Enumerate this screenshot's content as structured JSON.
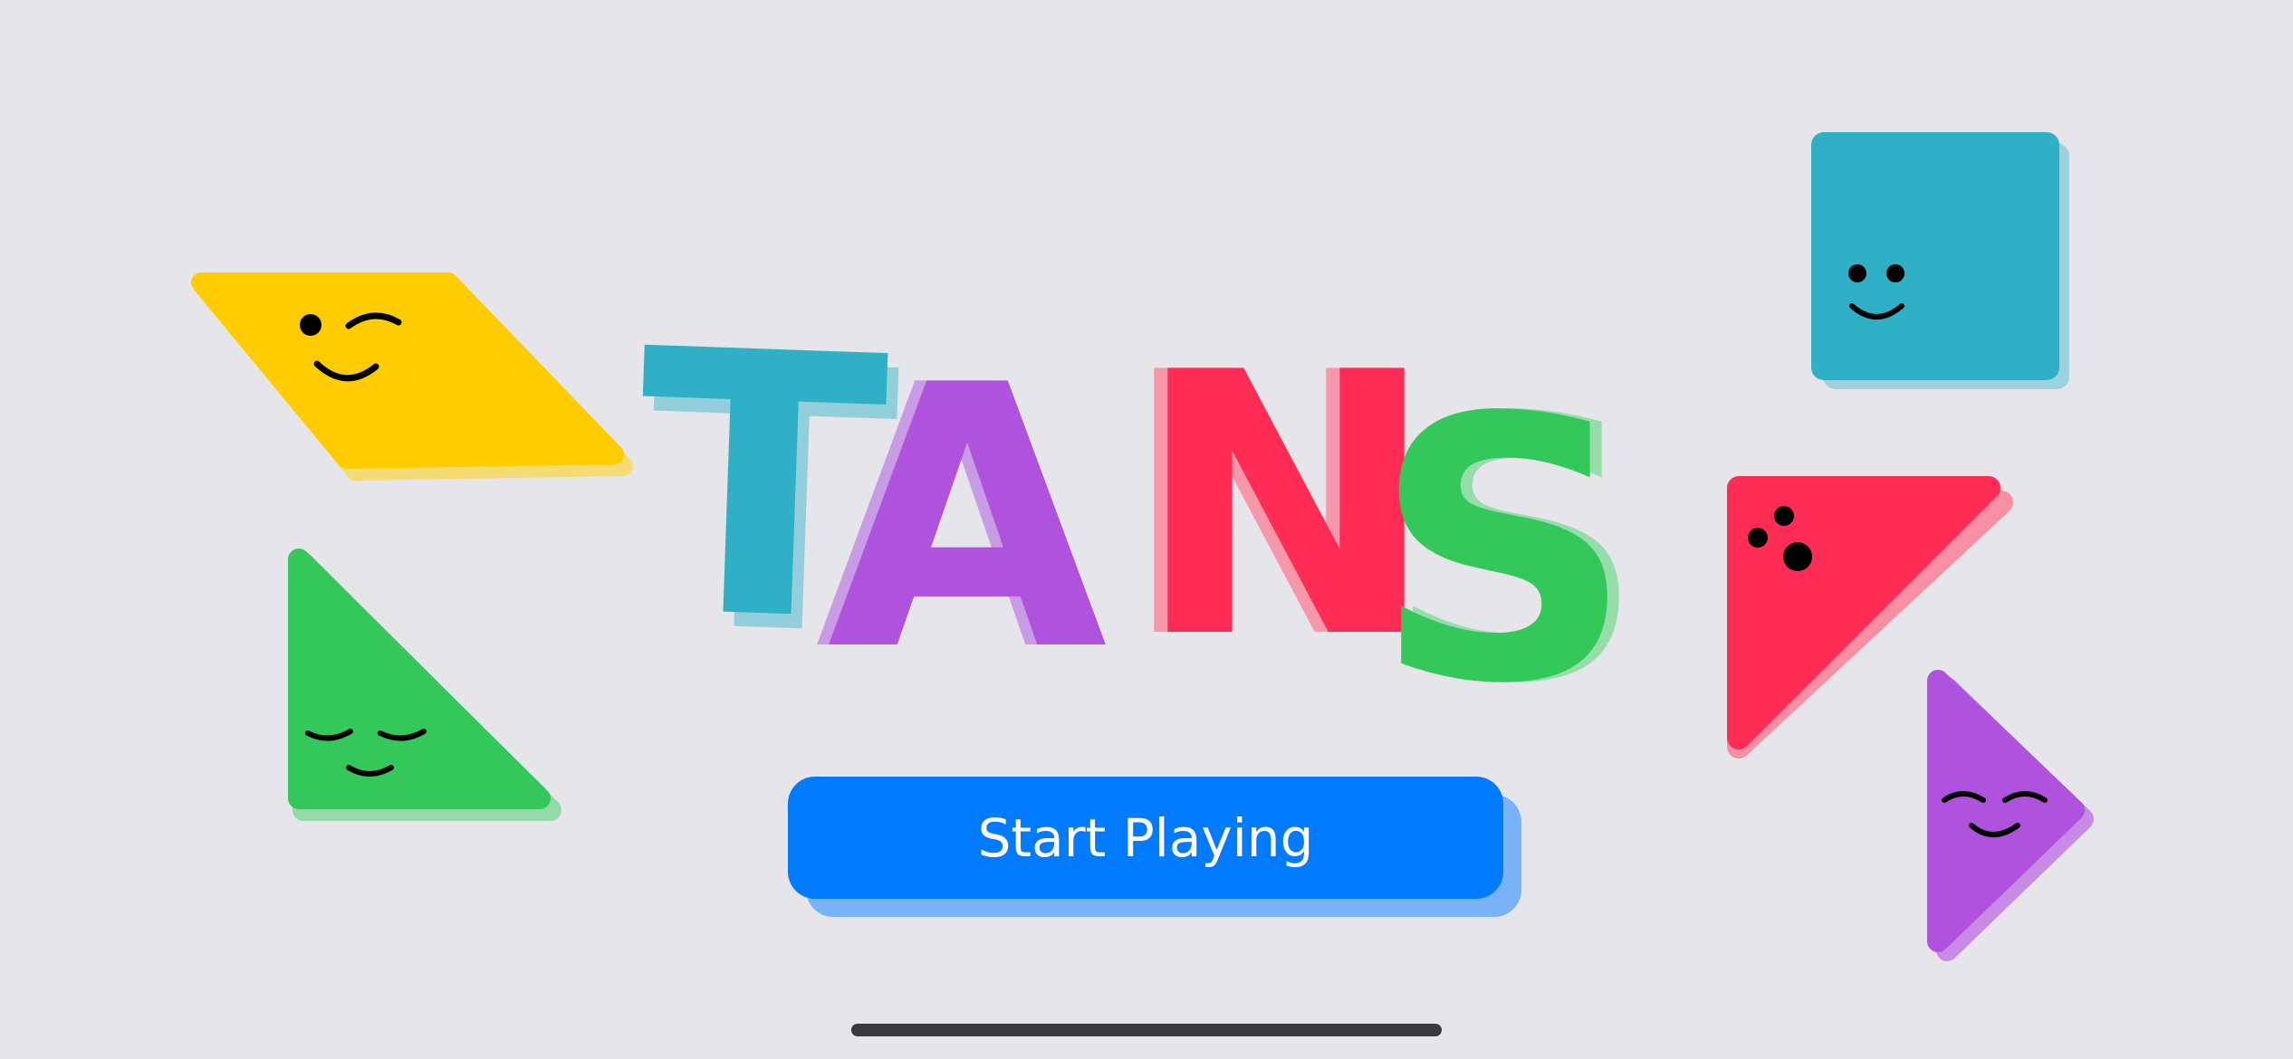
{
  "app": {
    "title": "TANS",
    "title_letters": [
      "T",
      "A",
      "N",
      "S"
    ]
  },
  "start_button": {
    "label": "Start Playing"
  },
  "colors": {
    "background": "#E5E5EA",
    "yellow": "#FFCC00",
    "teal": "#30B0C7",
    "purple": "#AF52DE",
    "red": "#FF2D55",
    "green": "#34C759",
    "blue": "#007AFF",
    "face": "#000000"
  },
  "characters": [
    {
      "shape": "parallelogram",
      "color": "yellow",
      "expression": "wink"
    },
    {
      "shape": "right-triangle",
      "color": "green",
      "expression": "sleepy"
    },
    {
      "shape": "square",
      "color": "teal",
      "expression": "smile"
    },
    {
      "shape": "right-triangle",
      "color": "red",
      "expression": "freckles"
    },
    {
      "shape": "triangle",
      "color": "purple",
      "expression": "content"
    }
  ],
  "icons": {
    "home_indicator": "home-indicator-bar"
  }
}
